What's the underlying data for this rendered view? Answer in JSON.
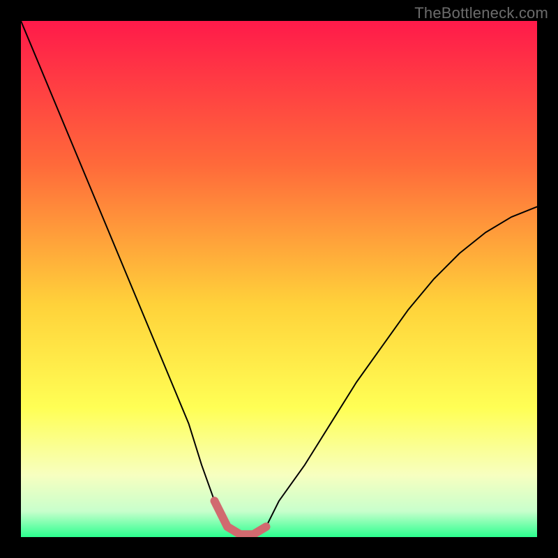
{
  "watermark": {
    "text": "TheBottleneck.com"
  },
  "colors": {
    "frame": "#000000",
    "curve": "#000000",
    "highlight": "#d16a6f",
    "grad_top": "#ff1a4a",
    "grad_mid1": "#ff6a3a",
    "grad_mid2": "#ffd23a",
    "grad_mid3": "#ffff55",
    "grad_low1": "#f7ffc0",
    "grad_low2": "#c8ffcc",
    "grad_bottom": "#2bff8f"
  },
  "chart_data": {
    "type": "line",
    "title": "",
    "xlabel": "",
    "ylabel": "",
    "xlim": [
      0,
      100
    ],
    "ylim": [
      0,
      100
    ],
    "x": [
      0,
      5,
      10,
      15,
      20,
      25,
      30,
      32.5,
      35,
      37.5,
      40,
      42.5,
      45,
      47.5,
      50,
      55,
      60,
      65,
      70,
      75,
      80,
      85,
      90,
      95,
      100
    ],
    "series": [
      {
        "name": "bottleneck-curve",
        "values": [
          100,
          88,
          76,
          64,
          52,
          40,
          28,
          22,
          14,
          7,
          2,
          0.5,
          0.5,
          2,
          7,
          14,
          22,
          30,
          37,
          44,
          50,
          55,
          59,
          62,
          64
        ]
      }
    ],
    "highlight_range_x": [
      37.5,
      47.5
    ],
    "annotations": []
  }
}
